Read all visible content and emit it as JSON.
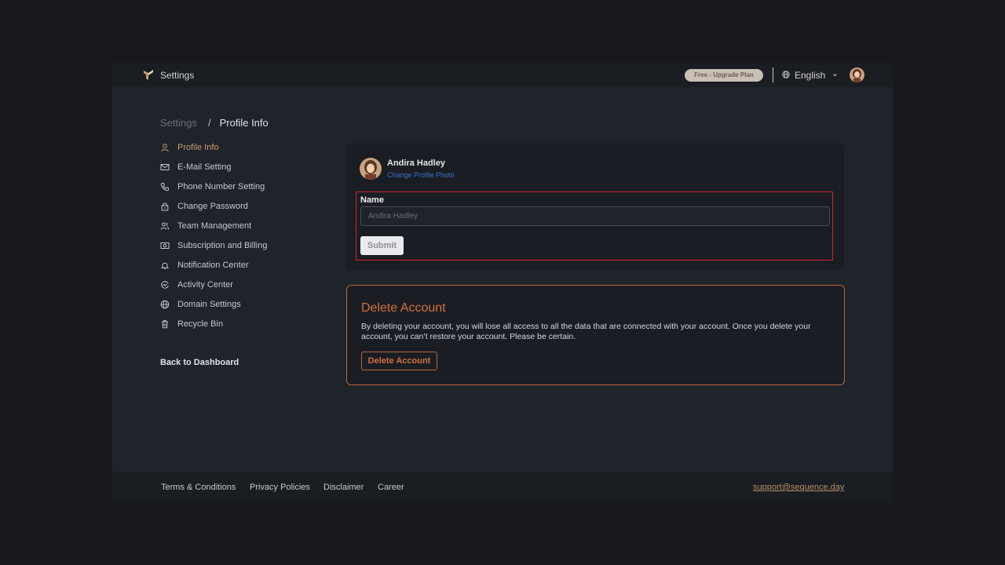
{
  "header": {
    "app_title": "Settings",
    "plan_badge": "Free - Upgrade Plan",
    "language": "English"
  },
  "breadcrumb": {
    "root": "Settings",
    "separator": "/",
    "current": "Profile Info"
  },
  "sidebar": {
    "items": [
      {
        "label": "Profile Info",
        "icon": "user-icon",
        "active": true
      },
      {
        "label": "E-Mail Setting",
        "icon": "mail-icon"
      },
      {
        "label": "Phone Number Setting",
        "icon": "phone-icon"
      },
      {
        "label": "Change Password",
        "icon": "lock-icon"
      },
      {
        "label": "Team Management",
        "icon": "team-icon"
      },
      {
        "label": "Subscription and Billing",
        "icon": "billing-icon"
      },
      {
        "label": "Notification Center",
        "icon": "bell-icon"
      },
      {
        "label": "Activity Center",
        "icon": "activity-icon"
      },
      {
        "label": "Domain Settings",
        "icon": "globe-icon"
      },
      {
        "label": "Recycle Bin",
        "icon": "trash-icon"
      }
    ],
    "back_label": "Back to Dashboard"
  },
  "profile": {
    "name": "Andira Hadley",
    "change_photo_label": "Change Profile Photo",
    "name_field_label": "Name",
    "name_placeholder": "Andira Hadley",
    "submit_label": "Submit"
  },
  "delete_account": {
    "title": "Delete Account",
    "description": "By deleting your account, you will lose all access to all the data that are connected with your account. Once you delete your account, you can’t restore your account. Please be certain.",
    "button_label": "Delete Account"
  },
  "footer": {
    "links": [
      "Terms & Conditions",
      "Privacy Policies",
      "Disclaimer",
      "Career"
    ],
    "support_email": "support@sequence.day"
  },
  "colors": {
    "accent": "#c99d6e",
    "danger": "#d2703f",
    "link": "#3d72c9",
    "highlight": "#d0242a"
  }
}
